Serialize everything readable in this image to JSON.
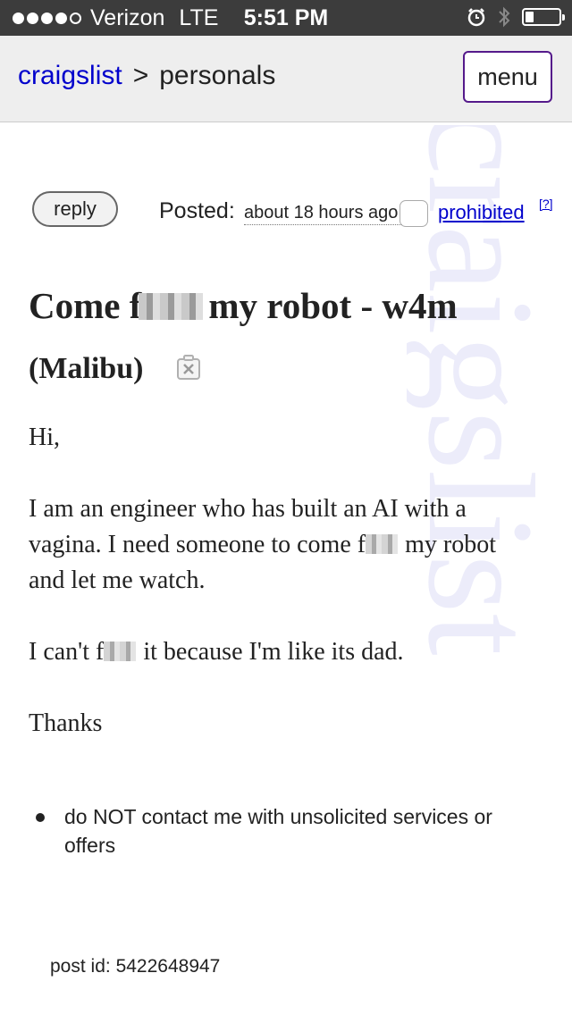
{
  "status_bar": {
    "carrier": "Verizon",
    "network": "LTE",
    "time": "5:51 PM",
    "signal_bars_filled": 4,
    "signal_bars_total": 5,
    "battery_level_fraction": 0.25
  },
  "nav": {
    "site_link": "craigslist",
    "separator": ">",
    "section": "personals",
    "menu_label": "menu",
    "link_color": "#0000cc",
    "menu_border_color": "#551a8b"
  },
  "watermark": "craigslist",
  "post": {
    "reply_label": "reply",
    "posted_label": "Posted:",
    "posted_time": "about 18 hours ago",
    "prohibited_label": "prohibited",
    "help_label": "[?]",
    "title_part1": "Come f",
    "title_part2": "my robot - w4m",
    "location": "(Malibu)",
    "greeting": "Hi,",
    "para1_part1": "I am an engineer who has built an AI with a vagina. I need someone to come f",
    "para1_part2": "my robot and let me watch.",
    "para2_part1": "I can't f",
    "para2_part2": "it because I'm like its dad.",
    "signoff": "Thanks",
    "notice": "do NOT contact me with unsolicited services or offers",
    "post_id_label": "post id:",
    "post_id": "5422648947"
  }
}
